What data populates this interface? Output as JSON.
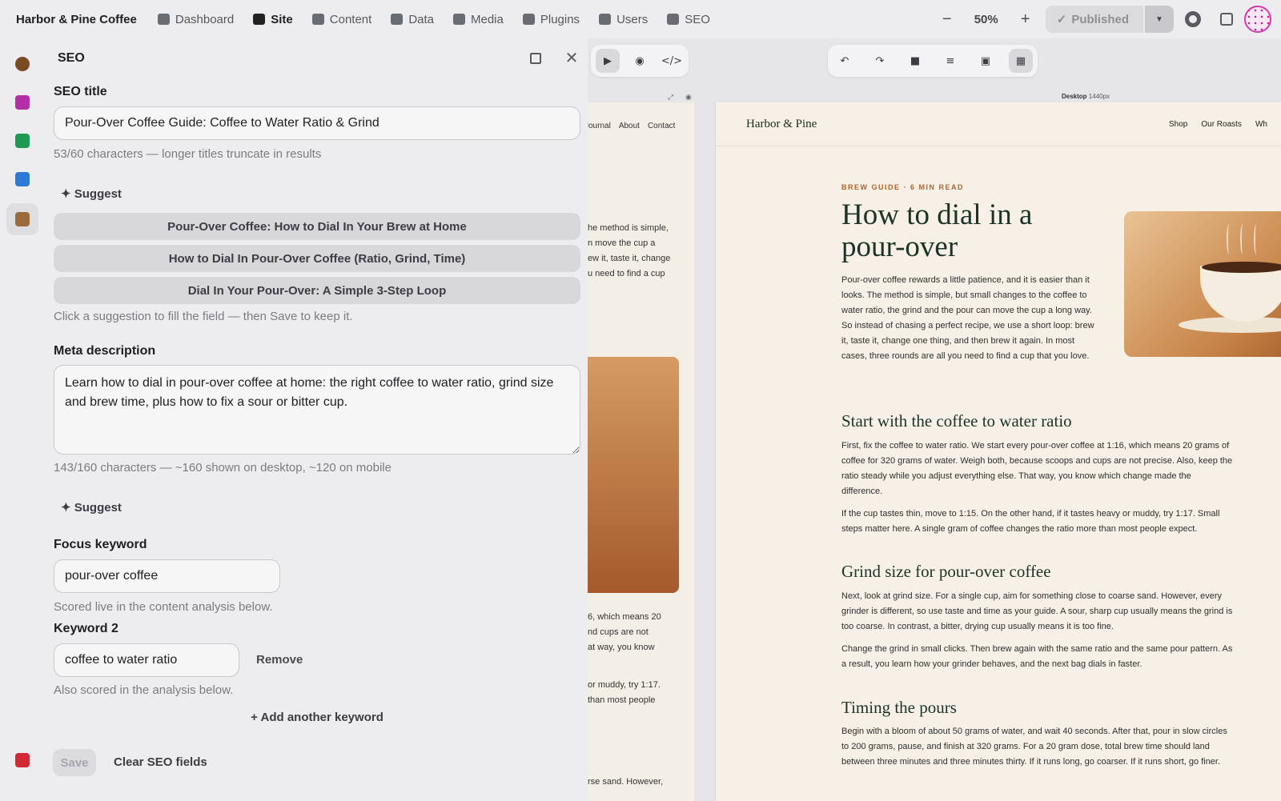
{
  "app": {
    "brand": "Harbor & Pine Coffee",
    "nav": [
      {
        "label": "Dashboard",
        "icon": "dashboard-icon"
      },
      {
        "label": "Site",
        "icon": "site-icon"
      },
      {
        "label": "Content",
        "icon": "content-icon"
      },
      {
        "label": "Data",
        "icon": "database-icon"
      },
      {
        "label": "Media",
        "icon": "media-icon"
      },
      {
        "label": "Plugins",
        "icon": "plugins-icon"
      },
      {
        "label": "Users",
        "icon": "users-icon"
      },
      {
        "label": "SEO",
        "icon": "seo-icon"
      }
    ],
    "active_nav": "Site",
    "zoom": "50%",
    "publish_label": "Published"
  },
  "seo": {
    "panel_title": "SEO",
    "title_label": "SEO title",
    "title_value": "Pour-Over Coffee Guide: Coffee to Water Ratio & Grind",
    "title_hint": "53/60 characters — longer titles truncate in results",
    "suggest_label": "✦ Suggest",
    "suggestions": [
      "Pour-Over Coffee: How to Dial In Your Brew at Home",
      "How to Dial In Pour-Over Coffee (Ratio, Grind, Time)",
      "Dial In Your Pour-Over: A Simple 3-Step Loop"
    ],
    "suggestions_hint": "Click a suggestion to fill the field — then Save to keep it.",
    "meta_label": "Meta description",
    "meta_value": "Learn how to dial in pour-over coffee at home: the right coffee to water ratio, grind size and brew time, plus how to fix a sour or bitter cup.",
    "meta_hint": "143/160 characters — ~160 shown on desktop, ~120 on mobile",
    "focus_label": "Focus keyword",
    "focus_value": "pour-over coffee",
    "focus_hint": "Scored live in the content analysis below.",
    "kw2_label": "Keyword 2",
    "kw2_value": "coffee to water ratio",
    "remove_label": "Remove",
    "kw2_hint": "Also scored in the analysis below.",
    "add_keyword_label": "+ Add another keyword",
    "save_label": "Save",
    "clear_label": "Clear SEO fields"
  },
  "canvas": {
    "frame_label": "Desktop",
    "frame_size": "1440px",
    "mini": {
      "nav": [
        "Journal",
        "About",
        "Contact"
      ],
      "lines_top": [
        "he method is simple,",
        "n move the cup a",
        "ew it, taste it, change",
        "u need to find a cup"
      ],
      "lines_mid": [
        "6, which means 20",
        "nd cups are not",
        "at way, you know"
      ],
      "lines_low": [
        "or muddy, try 1:17.",
        "than most people"
      ],
      "line_bottom": "rse sand. However,"
    },
    "site": {
      "logo": "Harbor & Pine",
      "nav": [
        "Shop",
        "Our Roasts",
        "Wh"
      ],
      "eyebrow": "BREW GUIDE · 6 MIN READ",
      "h1": "How to dial in a pour-over",
      "intro": "Pour-over coffee rewards a little patience, and it is easier than it looks. The method is simple, but small changes to the coffee to water ratio, the grind and the pour can move the cup a long way. So instead of chasing a perfect recipe, we use a short loop: brew it, taste it, change one thing, and then brew it again. In most cases, three rounds are all you need to find a cup that you love.",
      "sections": [
        {
          "h2": "Start with the coffee to water ratio",
          "p1": "First, fix the coffee to water ratio. We start every pour-over coffee at 1:16, which means 20 grams of coffee for 320 grams of water. Weigh both, because scoops and cups are not precise. Also, keep the ratio steady while you adjust everything else. That way, you know which change made the difference.",
          "p2": "If the cup tastes thin, move to 1:15. On the other hand, if it tastes heavy or muddy, try 1:17. Small steps matter here. A single gram of coffee changes the ratio more than most people expect."
        },
        {
          "h2": "Grind size for pour-over coffee",
          "p1": "Next, look at grind size. For a single cup, aim for something close to coarse sand. However, every grinder is different, so use taste and time as your guide. A sour, sharp cup usually means the grind is too coarse. In contrast, a bitter, drying cup usually means it is too fine.",
          "p2": "Change the grind in small clicks. Then brew again with the same ratio and the same pour pattern. As a result, you learn how your grinder behaves, and the next bag dials in faster."
        },
        {
          "h2": "Timing the pours",
          "p1": "Begin with a bloom of about 50 grams of water, and wait 40 seconds. After that, pour in slow circles to 200 grams, pause, and finish at 320 grams. For a 20 gram dose, total brew time should land between three minutes and three minutes thirty. If it runs long, go coarser. If it runs short, go finer."
        }
      ]
    }
  }
}
